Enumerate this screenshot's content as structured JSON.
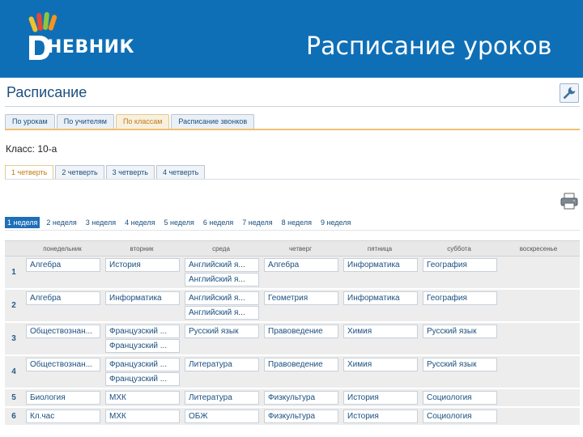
{
  "banner": {
    "logo_text": "НЕВНИК",
    "logo_letter": "D",
    "title": "Расписание уроков"
  },
  "page": {
    "title": "Расписание",
    "class_label": "Класс: 10-а"
  },
  "tabs": [
    {
      "label": "По урокам",
      "active": false
    },
    {
      "label": "По учителям",
      "active": false
    },
    {
      "label": "По классам",
      "active": true
    },
    {
      "label": "Расписание звонков",
      "active": false
    }
  ],
  "quarters": [
    {
      "label": "1 четверть",
      "active": true
    },
    {
      "label": "2 четверть",
      "active": false
    },
    {
      "label": "3 четверть",
      "active": false
    },
    {
      "label": "4 четверть",
      "active": false
    }
  ],
  "weeks": [
    {
      "label": "1 неделя",
      "active": true
    },
    {
      "label": "2 неделя",
      "active": false
    },
    {
      "label": "3 неделя",
      "active": false
    },
    {
      "label": "4 неделя",
      "active": false
    },
    {
      "label": "5 неделя",
      "active": false
    },
    {
      "label": "6 неделя",
      "active": false
    },
    {
      "label": "7 неделя",
      "active": false
    },
    {
      "label": "8 неделя",
      "active": false
    },
    {
      "label": "9 неделя",
      "active": false
    }
  ],
  "days": [
    "понедельник",
    "вторник",
    "среда",
    "четверг",
    "пятница",
    "суббота",
    "воскресенье"
  ],
  "rows": [
    {
      "num": "1",
      "cells": [
        [
          "Алгебра"
        ],
        [
          "История"
        ],
        [
          "Английский я...",
          "Английский я..."
        ],
        [
          "Алгебра"
        ],
        [
          "Информатика"
        ],
        [
          "География"
        ],
        []
      ]
    },
    {
      "num": "2",
      "cells": [
        [
          "Алгебра"
        ],
        [
          "Информатика"
        ],
        [
          "Английский я...",
          "Английский я..."
        ],
        [
          "Геометрия"
        ],
        [
          "Информатика"
        ],
        [
          "География"
        ],
        []
      ]
    },
    {
      "num": "3",
      "cells": [
        [
          "Обществознан..."
        ],
        [
          "Французский ...",
          "Французский ..."
        ],
        [
          "Русский язык"
        ],
        [
          "Правоведение"
        ],
        [
          "Химия"
        ],
        [
          "Русский язык"
        ],
        []
      ]
    },
    {
      "num": "4",
      "cells": [
        [
          "Обществознан..."
        ],
        [
          "Французский ...",
          "Французский ..."
        ],
        [
          "Литература"
        ],
        [
          "Правоведение"
        ],
        [
          "Химия"
        ],
        [
          "Русский язык"
        ],
        []
      ]
    },
    {
      "num": "5",
      "cells": [
        [
          "Биология"
        ],
        [
          "МХК"
        ],
        [
          "Литература"
        ],
        [
          "Физкультура"
        ],
        [
          "История"
        ],
        [
          "Социология"
        ],
        []
      ]
    },
    {
      "num": "6",
      "cells": [
        [
          "Кл.час"
        ],
        [
          "МХК"
        ],
        [
          "ОБЖ"
        ],
        [
          "Физкультура"
        ],
        [
          "История"
        ],
        [
          "Социология"
        ],
        []
      ]
    }
  ],
  "icons": {
    "settings": "wrench-icon",
    "print": "printer-icon"
  },
  "colors": {
    "banner": "#0f6fb6",
    "active_tab": "#c07a10",
    "link": "#1b4f80",
    "active_week": "#1e6fb8"
  }
}
